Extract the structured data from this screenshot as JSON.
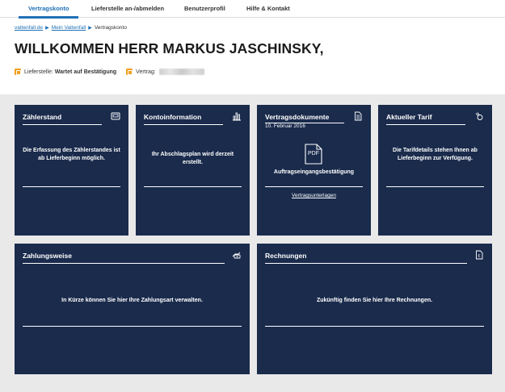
{
  "nav": {
    "tabs": [
      {
        "label": "Vertragskonto",
        "active": true
      },
      {
        "label": "Lieferstelle an-/abmelden"
      },
      {
        "label": "Benutzerprofil"
      },
      {
        "label": "Hilfe & Kontakt"
      }
    ]
  },
  "breadcrumb": {
    "items": [
      "vattenfall.de",
      "Mein Vattenfall",
      "Vertragskonto"
    ]
  },
  "page": {
    "title": "WILLKOMMEN HERR MARKUS JASCHINSKY,",
    "lieferstelle_label": "Lieferstelle:",
    "lieferstelle_value": "Wartet auf Bestätigung",
    "vertrag_label": "Vertrag:"
  },
  "cards": {
    "zaehlerstand": {
      "title": "Zählerstand",
      "icon": "meter-icon",
      "text": "Die Erfassung des Zählerstandes ist ab Lieferbeginn möglich."
    },
    "kontoinformation": {
      "title": "Kontoinformation",
      "icon": "bar-chart-icon",
      "text": "Ihr Abschlagsplan wird derzeit erstellt."
    },
    "vertragsdokumente": {
      "title": "Vertragsdokumente",
      "icon": "document-icon",
      "date": "10. Februar 2016",
      "pdf_label": "PDF",
      "doc_label": "Auftragseingangsbestätigung",
      "link": "Vertragsunterlagen"
    },
    "tarif": {
      "title": "Aktueller Tarif",
      "icon": "plug-icon",
      "text": "Die Tarifdetails stehen Ihnen ab Lieferbeginn zur Verfügung."
    },
    "zahlungsweise": {
      "title": "Zahlungsweise",
      "icon": "payment-icon",
      "text": "In Kürze können Sie hier Ihre Zahlungsart verwalten."
    },
    "rechnungen": {
      "title": "Rechnungen",
      "icon": "invoice-icon",
      "text": "Zukünftig finden Sie hier Ihre Rechnungen."
    }
  },
  "colors": {
    "accent": "#2071b5",
    "card_bg": "#1a2b4c",
    "panel_bg": "#e9e9e9",
    "status_icon": "#f0a020"
  }
}
